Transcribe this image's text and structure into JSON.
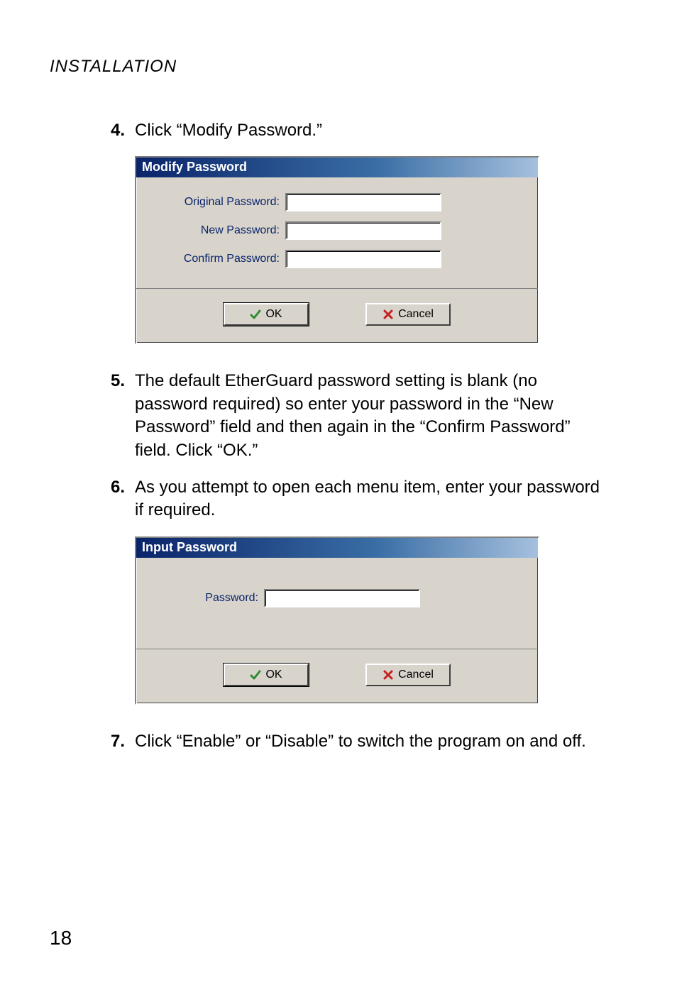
{
  "header": {
    "running_head": "INSTALLATION"
  },
  "steps": {
    "s4": {
      "num": "4.",
      "text": "Click “Modify Password.”"
    },
    "s5": {
      "num": "5.",
      "text": "The default EtherGuard password setting is blank (no password required) so enter your password in the “New Password” field and then again in the “Confirm Password” field. Click “OK.”"
    },
    "s6": {
      "num": "6.",
      "text": "As you attempt to open each menu item, enter your password if required."
    },
    "s7": {
      "num": "7.",
      "text": "Click “Enable” or “Disable” to switch the program on and off."
    }
  },
  "dialog1": {
    "title": "Modify Password",
    "labels": {
      "original": "Original Password:",
      "new": "New Password:",
      "confirm": "Confirm Password:"
    },
    "buttons": {
      "ok": "OK",
      "cancel": "Cancel"
    }
  },
  "dialog2": {
    "title": "Input Password",
    "labels": {
      "password": "Password:"
    },
    "buttons": {
      "ok": "OK",
      "cancel": "Cancel"
    }
  },
  "page_number": "18"
}
